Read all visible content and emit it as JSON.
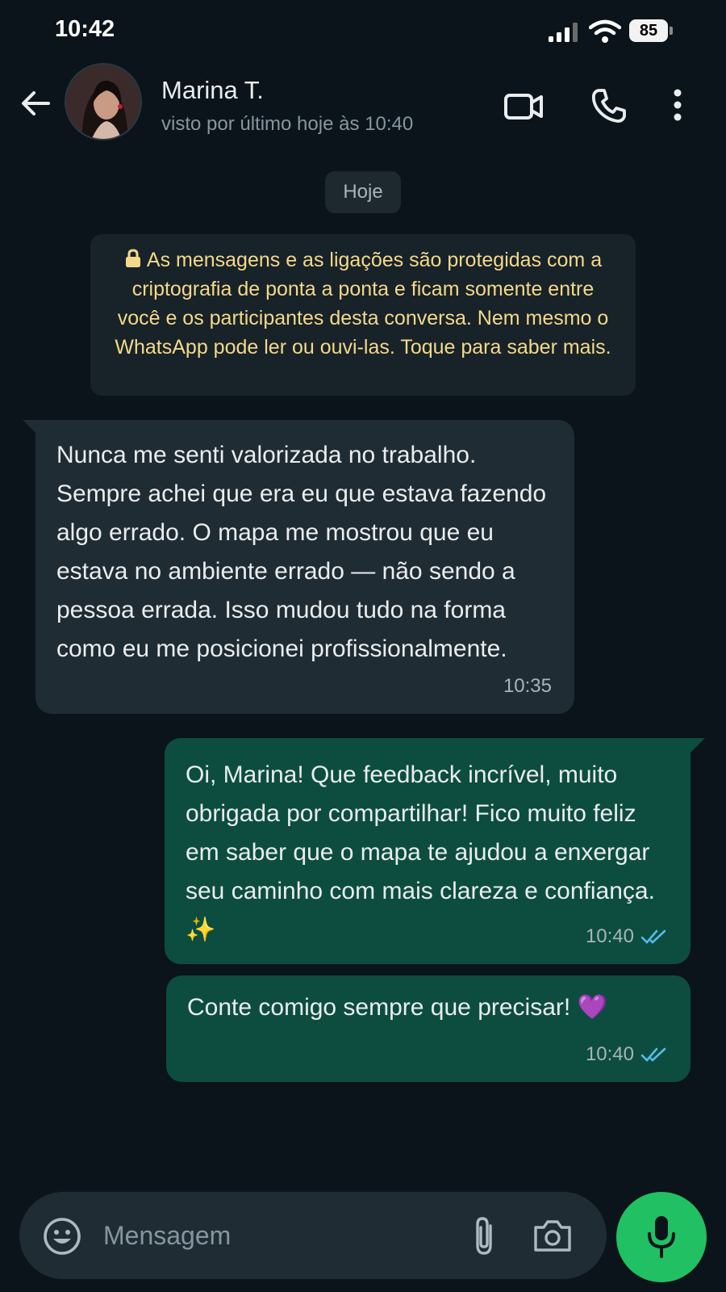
{
  "status_bar": {
    "time": "10:42",
    "battery": "85"
  },
  "header": {
    "contact_name": "Marina T.",
    "last_seen": "visto por último hoje às 10:40",
    "icons": [
      "back-arrow-icon",
      "video-call-icon",
      "phone-icon",
      "more-icon"
    ]
  },
  "chat": {
    "date_chip": "Hoje",
    "encryption_notice": "As mensagens e as ligações são protegidas com a criptografia de ponta a ponta e ficam somente entre você e os participantes desta conversa. Nem mesmo o WhatsApp pode ler ou ouvi-las. Toque para saber mais.",
    "messages": [
      {
        "direction": "incoming",
        "text": "Nunca me senti valorizada no trabalho. Sempre achei que era eu que estava fazendo algo errado. O mapa me mostrou que eu estava no ambiente errado — não sendo a pessoa errada. Isso mudou tudo na forma como eu me posicionei profissionalmente.",
        "time": "10:35"
      },
      {
        "direction": "outgoing",
        "text": "Oi, Marina! Que feedback incrível, muito obrigada por compartilhar! Fico muito feliz em saber que o mapa te ajudou a enxergar seu caminho com mais clareza e confiança. ✨",
        "time": "10:40",
        "status": "read"
      },
      {
        "direction": "outgoing",
        "text": "Conte comigo sempre que precisar! 💜",
        "time": "10:40",
        "status": "read"
      }
    ]
  },
  "input": {
    "placeholder": "Mensagem"
  },
  "colors": {
    "background": "#0b141a",
    "incoming_bubble": "#202c33",
    "outgoing_bubble": "#0d4d3f",
    "accent_green": "#21c063",
    "read_ticks": "#53bdeb",
    "notice_text": "#f4d98a"
  }
}
